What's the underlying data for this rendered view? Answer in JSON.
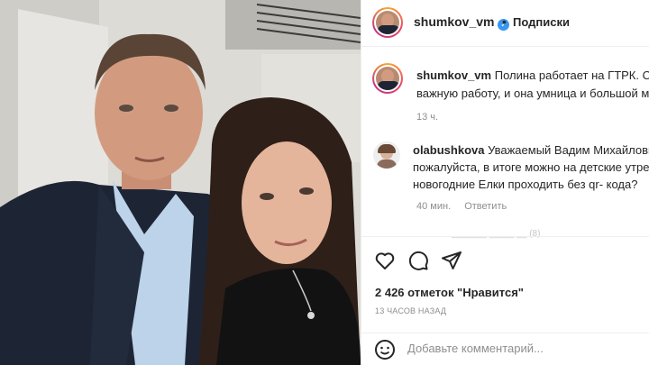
{
  "post": {
    "author": "shumkov_vm",
    "follow_label": "Подписки",
    "separator": "•"
  },
  "caption": {
    "username": "shumkov_vm",
    "line1": "Полина работает на ГТРК. О",
    "line2": "важную работу, и она умница и большой м",
    "time": "13 ч."
  },
  "comment": {
    "username": "olabushkova",
    "line1": "Уважаемый Вадим Михайлови",
    "line2": "пожалуйста, в итоге можно на детские утре",
    "line3": "новогодние Елки проходить без qr- кода?",
    "time": "40 мин.",
    "reply_label": "Ответить"
  },
  "faded_text": "_______ _____ __ (8)",
  "stats": {
    "likes": "2 426 отметок \"Нравится\"",
    "posted_ago": "13 ЧАСОВ НАЗАД"
  },
  "comment_box": {
    "placeholder": "Добавьте комментарий..."
  },
  "icons": {
    "verified": "verified-badge-icon",
    "like": "heart-icon",
    "comment": "comment-bubble-icon",
    "share": "paper-plane-icon",
    "emoji": "smiley-icon"
  },
  "colors": {
    "verified": "#3897f0",
    "muted": "#8e8e8e",
    "text": "#262626"
  }
}
